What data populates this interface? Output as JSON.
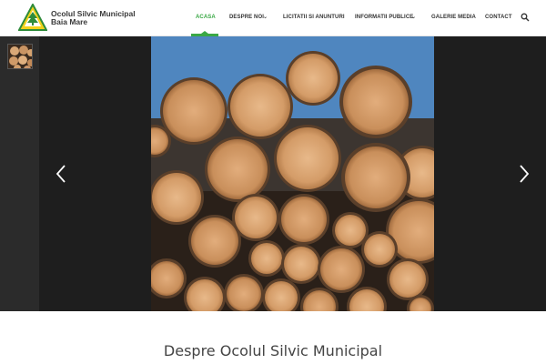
{
  "header": {
    "brand_line1": "Ocolul Silvic Municipal",
    "brand_line2": "Baia Mare",
    "logo_icon": "triangle-tree-logo-icon",
    "accent_color": "#3aa845"
  },
  "nav": {
    "items": [
      {
        "label": "ACASA",
        "active": true,
        "dropdown": false
      },
      {
        "label": "DESPRE NOI",
        "active": false,
        "dropdown": true
      },
      {
        "label": "LICITATII SI ANUNTURI",
        "active": false,
        "dropdown": false
      },
      {
        "label": "INFORMATII PUBLICE",
        "active": false,
        "dropdown": true
      },
      {
        "label": "GALERIE MEDIA",
        "active": false,
        "dropdown": false
      },
      {
        "label": "CONTACT",
        "active": false,
        "dropdown": false
      }
    ],
    "chevron": "⌄",
    "search_icon": "search-icon"
  },
  "slider": {
    "prev_icon": "chevron-left-icon",
    "next_icon": "chevron-right-icon",
    "image_subject": "stacked-logs-image"
  },
  "main": {
    "section_title": "Despre Ocolul Silvic Municipal"
  }
}
